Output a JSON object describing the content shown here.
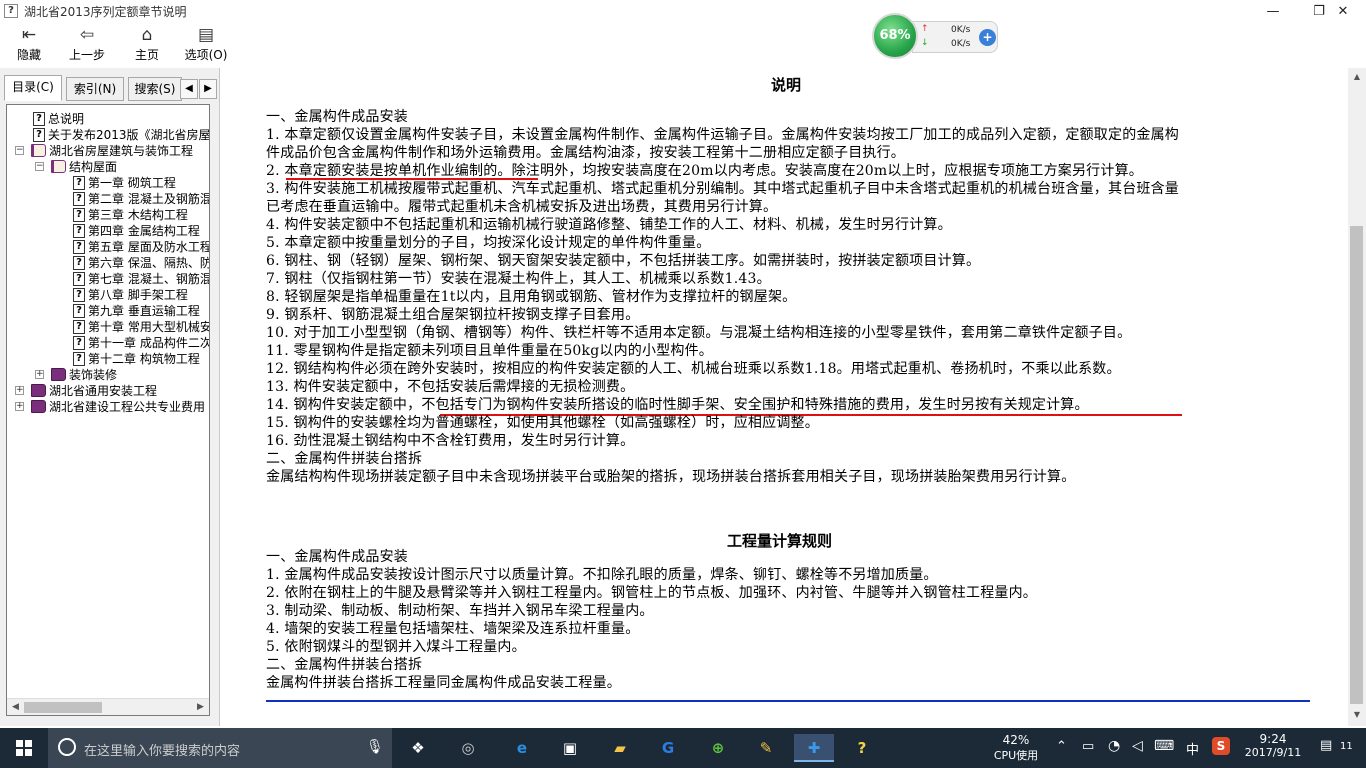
{
  "window": {
    "title": "湖北省2013序列定额章节说明",
    "minimize": "—",
    "restore": "❐",
    "close": "✕"
  },
  "toolbar": {
    "hide": "隐藏",
    "back": "上一步",
    "home": "主页",
    "options": "选项(O)"
  },
  "net_widget": {
    "percent": "68%",
    "up_speed": "0K/s",
    "down_speed": "0K/s"
  },
  "left_tabs": [
    "目录(C)",
    "索引(N)",
    "搜索(S)"
  ],
  "tree": [
    {
      "label": "总说明",
      "indent": 0
    },
    {
      "label": "关于发布2013版《湖北省房屋",
      "indent": 0
    },
    {
      "label": "湖北省房屋建筑与装饰工程",
      "indent": 0
    },
    {
      "label": "结构屋面",
      "indent": 1
    },
    {
      "label": "第一章  砌筑工程",
      "indent": 2
    },
    {
      "label": "第二章  混凝土及钢筋混",
      "indent": 2
    },
    {
      "label": "第三章  木结构工程",
      "indent": 2
    },
    {
      "label": "第四章  金属结构工程",
      "indent": 2
    },
    {
      "label": "第五章  屋面及防水工程",
      "indent": 2
    },
    {
      "label": "第六章  保温、隔热、防",
      "indent": 2
    },
    {
      "label": "第七章  混凝土、钢筋混",
      "indent": 2
    },
    {
      "label": "第八章  脚手架工程",
      "indent": 2
    },
    {
      "label": "第九章  垂直运输工程",
      "indent": 2
    },
    {
      "label": "第十章  常用大型机械安",
      "indent": 2
    },
    {
      "label": "第十一章  成品构件二次",
      "indent": 2
    },
    {
      "label": "第十二章  构筑物工程",
      "indent": 2
    },
    {
      "label": "装饰装修",
      "indent": 1
    },
    {
      "label": "湖北省通用安装工程",
      "indent": 0
    },
    {
      "label": "湖北省建设工程公共专业费用",
      "indent": 0
    }
  ],
  "content": {
    "heading1": "说明",
    "lines1": [
      "一、金属构件成品安装",
      "1. 本章定额仅设置金属构件安装子目，未设置金属构件制作、金属构件运输子目。金属构件安装均按工厂加工的成品列入定额，定额取定的金属构",
      "件成品价包含金属构件制作和场外运输费用。金属结构油漆，按安装工程第十二册相应定额子目执行。",
      "2. 本章定额安装是按单机作业编制的。除注明外，均按安装高度在20m以内考虑。安装高度在20m以上时，应根据专项施工方案另行计算。",
      "3. 构件安装施工机械按履带式起重机、汽车式起重机、塔式起重机分别编制。其中塔式起重机子目中未含塔式起重机的机械台班含量，其台班含量",
      "已考虑在垂直运输中。履带式起重机未含机械安拆及进出场费，其费用另行计算。",
      "4. 构件安装定额中不包括起重机和运输机械行驶道路修整、铺垫工作的人工、材料、机械，发生时另行计算。",
      "5. 本章定额中按重量划分的子目，均按深化设计规定的单件构件重量。",
      "6. 钢柱、钢（轻钢）屋架、钢桁架、钢天窗架安装定额中，不包括拼装工序。如需拼装时，按拼装定额项目计算。",
      "7. 钢柱（仅指钢柱第一节）安装在混凝土构件上，其人工、机械乘以系数1.43。",
      "8. 轻钢屋架是指单榀重量在1t以内，且用角钢或钢筋、管材作为支撑拉杆的钢屋架。",
      "9. 钢系杆、钢筋混凝土组合屋架钢拉杆按钢支撑子目套用。",
      "10. 对于加工小型型钢（角钢、槽钢等）构件、铁栏杆等不适用本定额。与混凝土结构相连接的小型零星铁件，套用第二章铁件定额子目。",
      "11. 零星钢构件是指定额未列项目且单件重量在50kg以内的小型构件。",
      "12. 钢结构构件必须在跨外安装时，按相应的构件安装定额的人工、机械台班乘以系数1.18。用塔式起重机、卷扬机时，不乘以此系数。",
      "13. 构件安装定额中，不包括安装后需焊接的无损检测费。",
      "14. 钢构件安装定额中，不包括专门为钢构件安装所搭设的临时性脚手架、安全围护和特殊措施的费用，发生时另按有关规定计算。",
      "15. 钢构件的安装螺栓均为普通螺栓，如使用其他螺栓（如高强螺栓）时，应相应调整。",
      "16. 劲性混凝土钢结构中不含栓钉费用，发生时另行计算。",
      "二、金属构件拼装台搭拆",
      "金属结构构件现场拼装定额子目中未含现场拼装平台或胎架的搭拆，现场拼装台搭拆套用相关子目，现场拼装胎架费用另行计算。"
    ],
    "heading2": "工程量计算规则",
    "lines2": [
      "一、金属构件成品安装",
      "1. 金属构件成品安装按设计图示尺寸以质量计算。不扣除孔眼的质量，焊条、铆钉、螺栓等不另增加质量。",
      "2. 依附在钢柱上的牛腿及悬臂梁等并入钢柱工程量内。钢管柱上的节点板、加强环、内衬管、牛腿等并入钢管柱工程量内。",
      "3. 制动梁、制动板、制动桁架、车挡并入钢吊车梁工程量内。",
      "4. 墙架的安装工程量包括墙架柱、墙架梁及连系拉杆重量。",
      "5. 依附钢煤斗的型钢并入煤斗工程量内。",
      "二、金属构件拼装台搭拆",
      "金属构件拼装台搭拆工程量同金属构件成品安装工程量。"
    ]
  },
  "taskbar": {
    "search_placeholder": "在这里输入你要搜索的内容",
    "cpu_percent": "42%",
    "cpu_label": "CPU使用",
    "ime": "中",
    "time": "9:24",
    "date": "2017/9/11",
    "notifications": "11"
  },
  "colors": {
    "underline": "#e01010",
    "rule": "#1030c0",
    "taskbar": "#1c2a38"
  }
}
